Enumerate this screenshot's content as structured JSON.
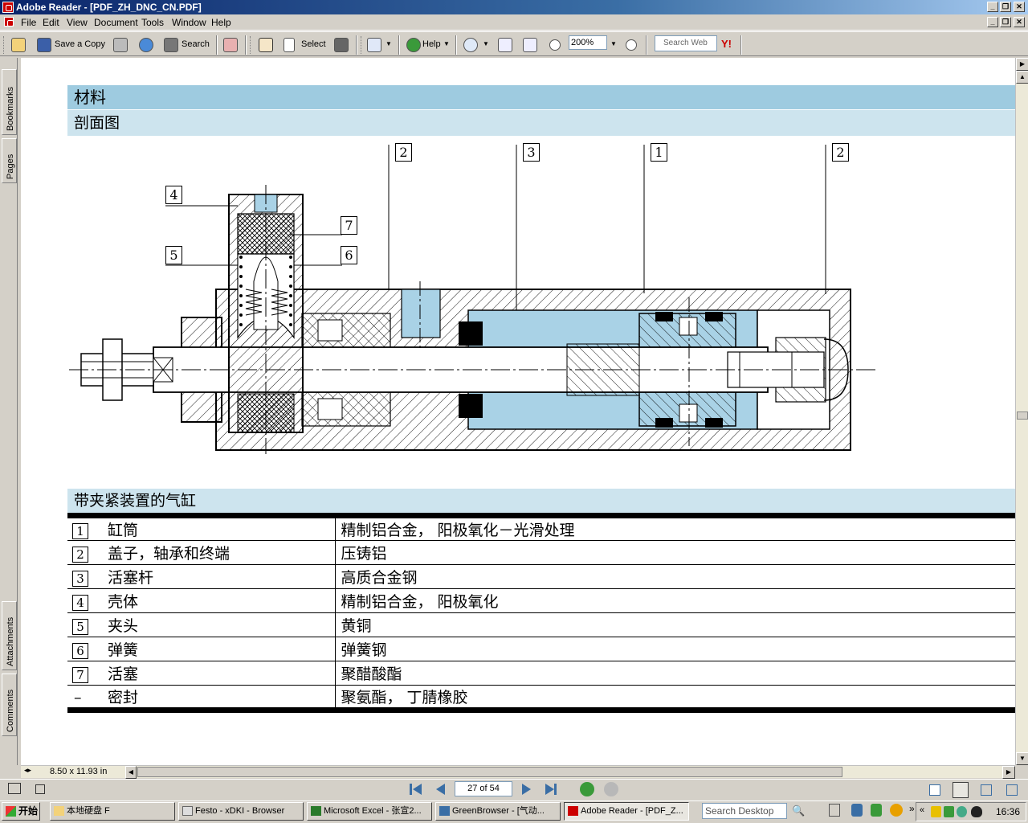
{
  "window": {
    "title": "Adobe Reader - [PDF_ZH_DNC_CN.PDF]"
  },
  "menu": [
    "File",
    "Edit",
    "View",
    "Document",
    "Tools",
    "Window",
    "Help"
  ],
  "toolbar": {
    "save_copy_label": "Save a Copy",
    "search_label": "Search",
    "select_label": "Select",
    "help_label": "Help",
    "zoom_value": "200%",
    "web_search_placeholder": "Search Web",
    "yahoo_label": "Y!"
  },
  "left_tabs": [
    "Bookmarks",
    "Pages",
    "Attachments",
    "Comments"
  ],
  "status": {
    "page_size": "8.50 x 11.93 in",
    "page_indicator": "27 of 54"
  },
  "document": {
    "heading_materials": "材料",
    "heading_section": "剖面图",
    "heading_table": "带夹紧装置的气缸",
    "callouts": [
      "2",
      "3",
      "1",
      "2",
      "4",
      "7",
      "5",
      "6"
    ],
    "materials": [
      {
        "num": "1",
        "part": "缸筒",
        "material": "精制铝合金， 阳极氧化－光滑处理"
      },
      {
        "num": "2",
        "part": "盖子，轴承和终端",
        "material": "压铸铝"
      },
      {
        "num": "3",
        "part": "活塞杆",
        "material": "高质合金钢"
      },
      {
        "num": "4",
        "part": "壳体",
        "material": "精制铝合金， 阳极氧化"
      },
      {
        "num": "5",
        "part": "夹头",
        "material": "黄铜"
      },
      {
        "num": "6",
        "part": "弹簧",
        "material": "弹簧钢"
      },
      {
        "num": "7",
        "part": "活塞",
        "material": "聚醋酸酯"
      },
      {
        "num": "–",
        "part": "密封",
        "material": "聚氨酯， 丁腈橡胶"
      }
    ]
  },
  "taskbar": {
    "start_label": "开始",
    "tasks": [
      "本地硬盘 F",
      "Festo - xDKI - Browser",
      "Microsoft Excel - 张宣2...",
      "GreenBrowser - [气动...",
      "Adobe Reader - [PDF_Z..."
    ],
    "desktop_search_placeholder": "Search Desktop",
    "clock": "16:36"
  },
  "colors": {
    "title_gradient_start": "#0a246a",
    "header_dark": "#9ecbe0",
    "header_light": "#cde4ee",
    "fluid_blue": "#a9d2e6"
  }
}
